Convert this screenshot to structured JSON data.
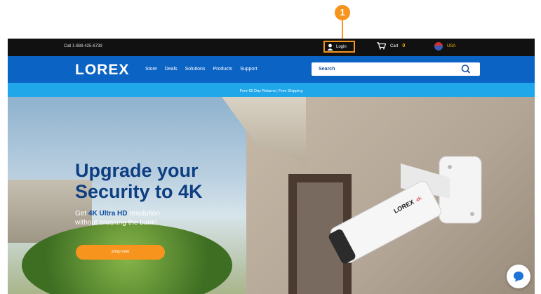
{
  "annotation": {
    "step_number": "1",
    "accent_color": "#f7941d"
  },
  "topbar": {
    "call_text": "Call 1-888-425-6739",
    "login_label": "Login",
    "cart_label": "Cart",
    "cart_count": "0",
    "region_label": "USA",
    "icons": {
      "user": "user-icon",
      "cart": "cart-icon",
      "flag": "us-flag-icon"
    }
  },
  "navbar": {
    "logo": "LOREX",
    "items": [
      "Store",
      "Deals",
      "Solutions",
      "Products",
      "Support"
    ],
    "search_placeholder": "Search",
    "brand_color": "#0b63c4"
  },
  "promo": {
    "text": "Free 60 Day Returns  |  Free Shipping",
    "color": "#1fa7ea"
  },
  "hero": {
    "title_line1": "Upgrade your",
    "title_line2": "Security to 4K",
    "subtitle_prefix": "Get",
    "subtitle_highlight": "4K Ultra HD",
    "subtitle_line1_rest": "resolution",
    "subtitle_line2": "without breaking the bank!",
    "cta_label": "shop now",
    "camera_brand": "LOREX",
    "camera_badge": "4K"
  }
}
